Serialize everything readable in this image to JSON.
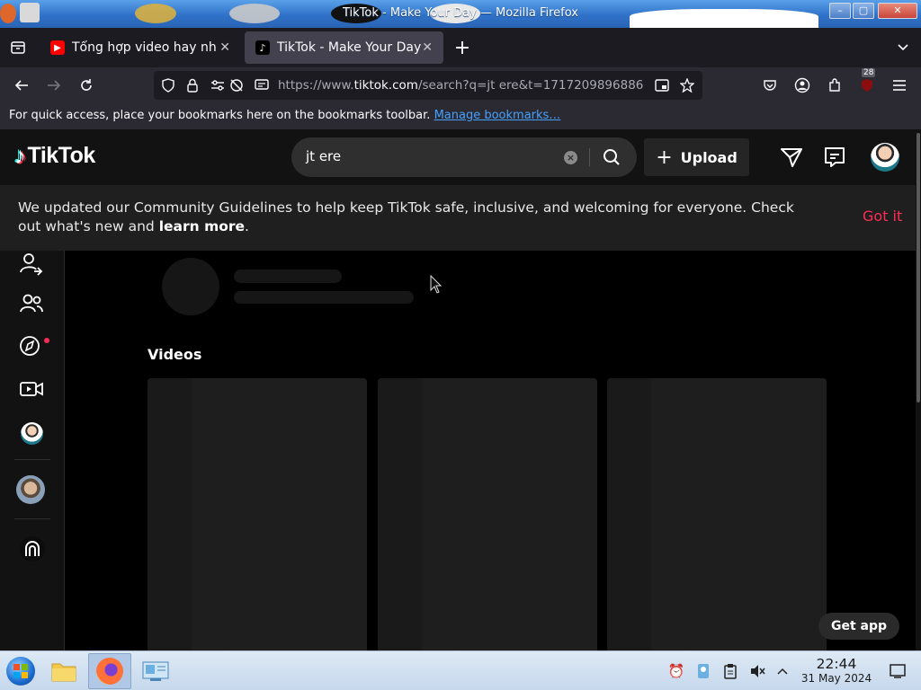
{
  "window": {
    "title": "TikTok - Make Your Day — Mozilla Firefox"
  },
  "tabs": [
    {
      "label": "Tổng hợp video hay nhất",
      "favicon": "youtube-icon",
      "active": false
    },
    {
      "label": "TikTok - Make Your Day",
      "favicon": "tiktok-icon",
      "active": true
    }
  ],
  "urlbar": {
    "url_prefix": "https://www.",
    "url_domain": "tiktok.com",
    "url_rest": "/search?q=jt ere&t=1717209896886"
  },
  "bookmarks": {
    "text": "For quick access, place your bookmarks here on the bookmarks toolbar.",
    "link": "Manage bookmarks…"
  },
  "toolbar": {
    "extensions_badge": "28"
  },
  "tiktok": {
    "logo": "TikTok",
    "search_value": "jt ere",
    "upload_label": "Upload",
    "banner": {
      "text": "We updated our Community Guidelines to help keep TikTok safe, inclusive, and welcoming for everyone. Check out what's new and ",
      "link": "learn more",
      "end": ".",
      "action": "Got it"
    },
    "videos_heading": "Videos",
    "get_app": "Get app",
    "accent": "#fe2c55"
  },
  "taskbar": {
    "time": "22:44",
    "date": "31 May 2024"
  }
}
